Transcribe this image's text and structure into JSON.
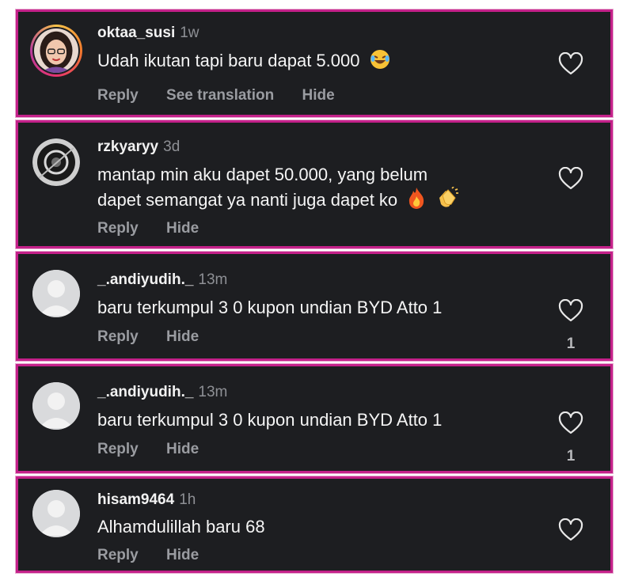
{
  "comments": [
    {
      "username": "oktaa_susi",
      "time": "1w",
      "text": "Udah ikutan tapi baru dapat 5.000",
      "emoji": [
        "laughing-tears-emoji"
      ],
      "actions": [
        "Reply",
        "See translation",
        "Hide"
      ],
      "likes": ""
    },
    {
      "username": "rzkyaryy",
      "time": "3d",
      "text_line1": "mantap min aku dapet 50.000, yang belum",
      "text_line2": "dapet semangat ya nanti juga dapet ko",
      "emoji": [
        "fire-emoji",
        "clapping-hands-emoji"
      ],
      "actions": [
        "Reply",
        "Hide"
      ],
      "likes": ""
    },
    {
      "username": "_.andiyudih._",
      "time": "13m",
      "text": "baru terkumpul 3 0 kupon undian BYD Atto 1",
      "actions": [
        "Reply",
        "Hide"
      ],
      "likes": "1"
    },
    {
      "username": "_.andiyudih._",
      "time": "13m",
      "text": "baru terkumpul 3 0 kupon undian BYD Atto 1",
      "actions": [
        "Reply",
        "Hide"
      ],
      "likes": "1"
    },
    {
      "username": "hisam9464",
      "time": "1h",
      "text": "Alhamdulillah baru 68",
      "actions": [
        "Reply",
        "Hide"
      ],
      "likes": ""
    }
  ],
  "colors": {
    "card_bg": "#1d1e21",
    "border": "#c4218a",
    "username": "#f2f2f2",
    "muted": "#8e9095"
  },
  "icons": [
    "heart-outline-icon",
    "default-avatar-icon"
  ]
}
